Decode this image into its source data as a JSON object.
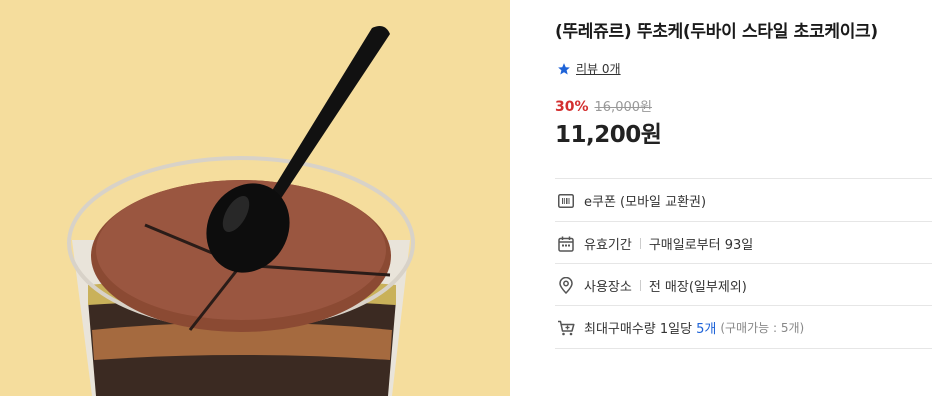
{
  "product": {
    "title": "(뚜레쥬르) 뚜초케(두바이 스타일 초코케이크)",
    "image_icon": "chocolate-cake-cup-photo",
    "review_label": "리뷰 0개",
    "discount_rate": "30%",
    "original_price": "16,000원",
    "sale_price": "11,200원"
  },
  "details": {
    "type_label": "e쿠폰 (모바일 교환권)",
    "validity_label": "유효기간",
    "validity_value": "구매일로부터 93일",
    "place_label": "사용장소",
    "place_value": "전 매장(일부제외)",
    "limit_label": "최대구매수량 1일당",
    "limit_value": "5개",
    "limit_note": "(구매가능 : 5개)"
  },
  "colors": {
    "image_background": "#f5dd9d",
    "discount": "#d32f2f",
    "accent_blue": "#1e63d8",
    "divider": "#e6e6e6"
  }
}
